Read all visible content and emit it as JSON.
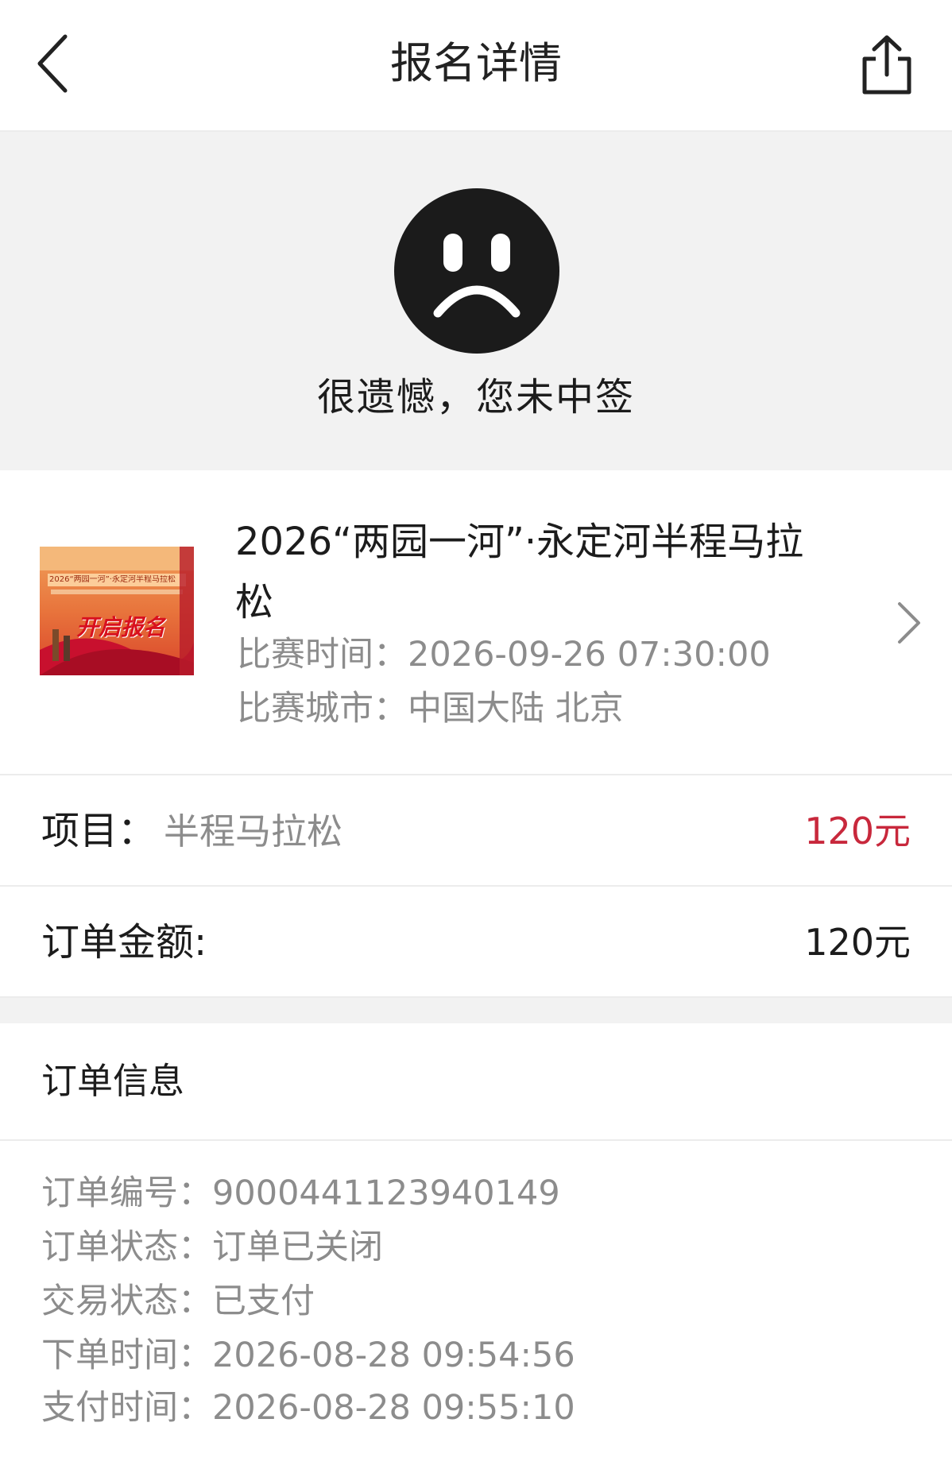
{
  "header": {
    "title": "报名详情",
    "back_icon": "chevron-left-icon",
    "share_icon": "share-icon"
  },
  "result": {
    "icon": "sad-face-icon",
    "message": "很遗憾，您未中签"
  },
  "event": {
    "title": "2026“两园一河”·永定河半程马拉松",
    "time_label": "比赛时间：",
    "time_value": "2026-09-26 07:30:00",
    "city_label": "比赛城市：",
    "city_value": "中国大陆 北京",
    "poster": {
      "headline": "开启报名",
      "subtitle": "2026“两园一河”·永定河半程马拉松"
    }
  },
  "item": {
    "label": "项目：",
    "value": "半程马拉松",
    "price": "120元"
  },
  "amount": {
    "label": "订单金额:",
    "price": "120元"
  },
  "order": {
    "section_title": "订单信息",
    "details": [
      {
        "label": "订单编号：",
        "value": "9000441123940149"
      },
      {
        "label": "订单状态：",
        "value": "订单已关闭"
      },
      {
        "label": "交易状态：",
        "value": "已支付"
      },
      {
        "label": "下单时间：",
        "value": "2026-08-28 09:54:56"
      },
      {
        "label": "支付时间：",
        "value": "2026-08-28 09:55:10"
      }
    ]
  },
  "colors": {
    "price_red": "#c8283c",
    "muted_text": "#8c8c8c",
    "banner_bg": "#f2f2f2"
  }
}
